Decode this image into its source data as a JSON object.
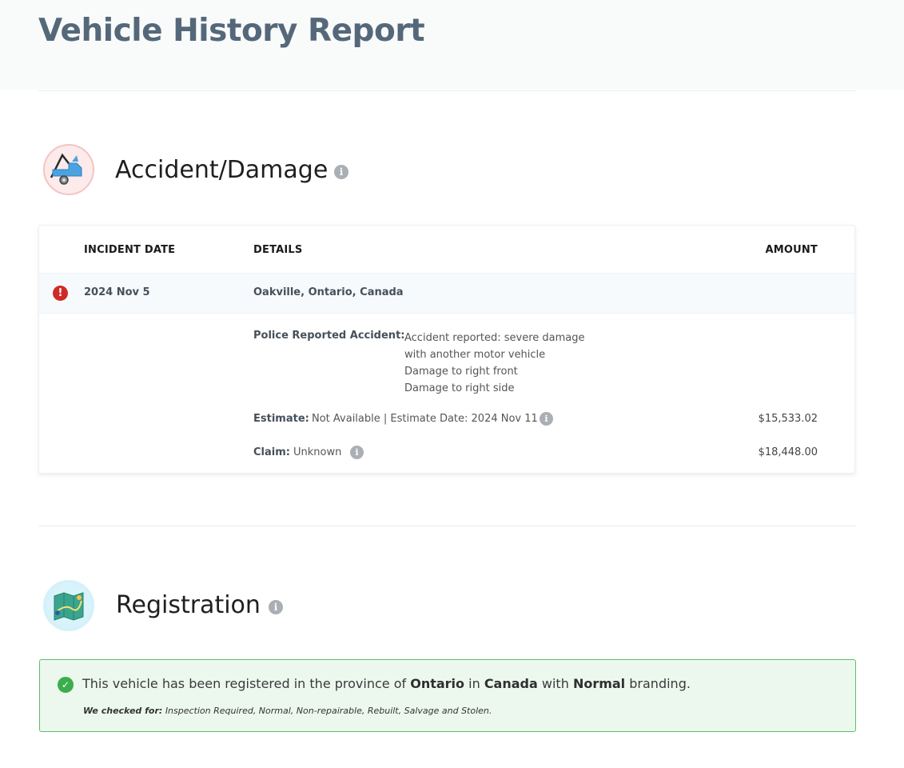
{
  "page": {
    "title": "Vehicle History Report"
  },
  "accident": {
    "title": "Accident/Damage",
    "columns": {
      "date": "INCIDENT DATE",
      "details": "DETAILS",
      "amount": "AMOUNT"
    },
    "incident": {
      "date": "2024 Nov 5",
      "location": "Oakville, Ontario, Canada",
      "police_label": "Police Reported Accident:",
      "police_lines": [
        "Accident reported: severe damage",
        "with another motor vehicle",
        "Damage to right front",
        "Damage to right side"
      ],
      "estimate_label": "Estimate:",
      "estimate_text": "Not Available | Estimate Date: 2024 Nov 11",
      "estimate_amount": "$15,533.02",
      "claim_label": "Claim:",
      "claim_text": "Unknown",
      "claim_amount": "$18,448.00"
    }
  },
  "registration": {
    "title": "Registration",
    "message_prefix": "This vehicle has been registered in the province of",
    "province": "Ontario",
    "in_word": "in",
    "country": "Canada",
    "with_word": "with",
    "branding": "Normal",
    "message_suffix": "branding.",
    "checked_label": "We checked for:",
    "checked_items": "Inspection Required, Normal, Non-repairable, Rebuilt, Salvage and Stolen."
  },
  "icons": {
    "accident": "tow-truck-icon",
    "registration": "map-icon",
    "info": "info-icon",
    "alert": "alert-icon",
    "check": "check-icon"
  },
  "colors": {
    "title": "#54687a",
    "alert": "#cf2a27",
    "success_border": "#5cbf6b",
    "success_bg": "#ecf8ee"
  }
}
